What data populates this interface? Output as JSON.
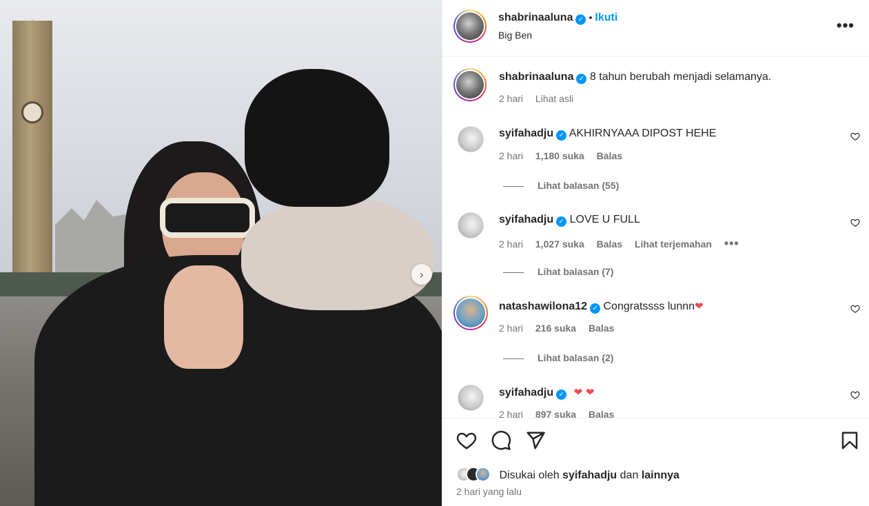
{
  "post": {
    "author": "shabrinaaluna",
    "follow_label": "Ikuti",
    "dot": "•",
    "location": "Big Ben",
    "more_label": "•••",
    "next_label": "›"
  },
  "caption": {
    "user": "shabrinaaluna",
    "text": "8 tahun berubah menjadi selamanya.",
    "time": "2 hari",
    "see_original": "Lihat asli"
  },
  "comments": [
    {
      "user": "syifahadju",
      "text": "AKHIRNYAAA DIPOST HEHE",
      "time": "2 hari",
      "likes": "1,180 suka",
      "reply": "Balas",
      "replies": "Lihat balasan (55)"
    },
    {
      "user": "syifahadju",
      "text": "LOVE U FULL",
      "time": "2 hari",
      "likes": "1,027 suka",
      "reply": "Balas",
      "translate": "Lihat terjemahan",
      "more": "•••",
      "replies": "Lihat balasan (7)"
    },
    {
      "user": "natashawilona12",
      "text": "Congratssss lunnn",
      "emoji": "❤",
      "time": "2 hari",
      "likes": "216 suka",
      "reply": "Balas",
      "replies": "Lihat balasan (2)"
    },
    {
      "user": "syifahadju",
      "text": "",
      "emoji": "❤ ❤",
      "time": "2 hari",
      "likes": "897 suka",
      "reply": "Balas"
    }
  ],
  "icons": {
    "verified": "✓",
    "like": "heart-icon",
    "comment": "comment-icon",
    "share": "share-icon",
    "save": "bookmark-icon"
  },
  "likes": {
    "prefix": "Disukai oleh",
    "user": "syifahadju",
    "and": "dan",
    "others": "lainnya"
  },
  "timestamp": "2 hari yang lalu",
  "colors": {
    "accent": "#0095f6",
    "text": "#262626",
    "muted": "#737373",
    "heart": "#ed4956"
  }
}
